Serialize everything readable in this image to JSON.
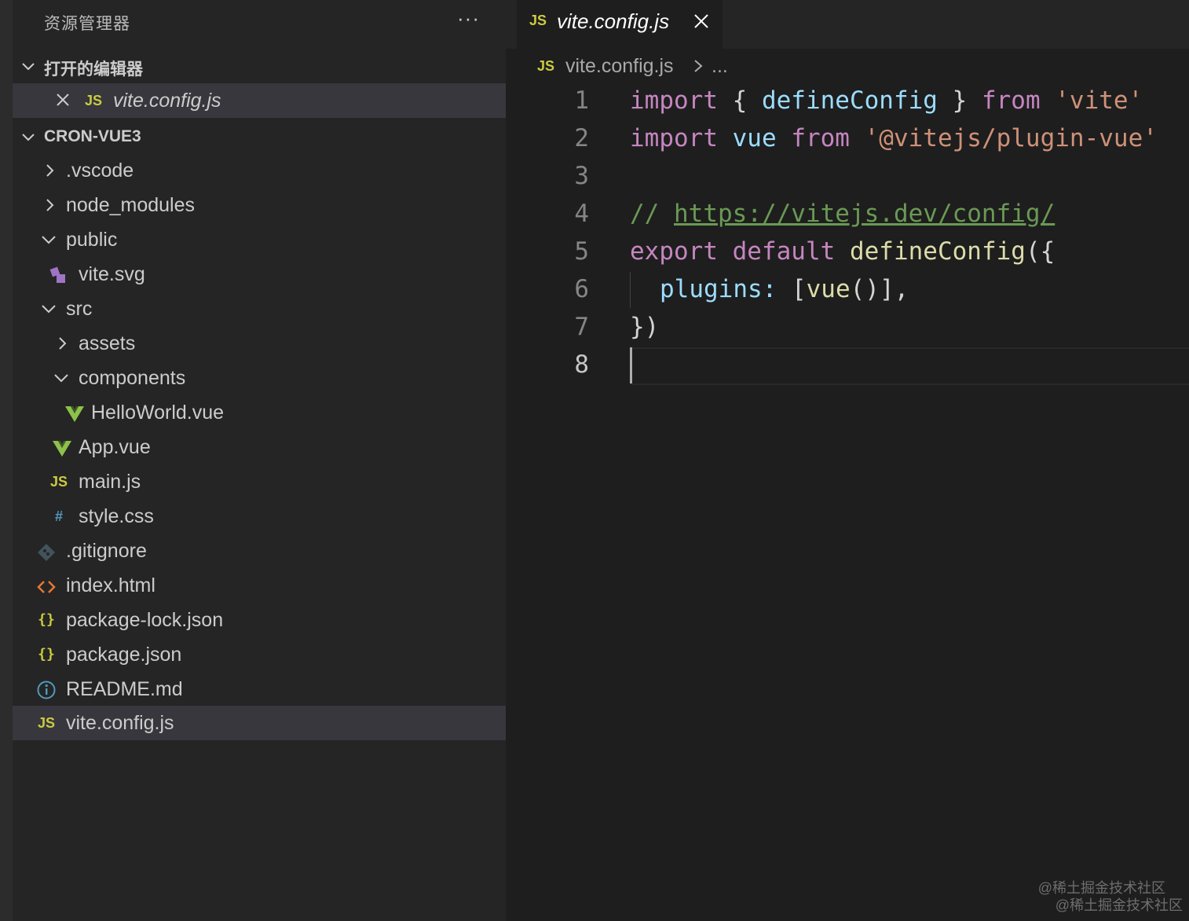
{
  "sidebar": {
    "title": "资源管理器",
    "more_label": "···",
    "open_editors_label": "打开的编辑器",
    "open_editors": [
      {
        "icon": "javascript-file-icon",
        "label": "vite.config.js"
      }
    ],
    "project_label": "CRON-VUE3",
    "tree": [
      {
        "label": ".vscode",
        "type": "folder",
        "expanded": false,
        "depth": 0
      },
      {
        "label": "node_modules",
        "type": "folder",
        "expanded": false,
        "depth": 0
      },
      {
        "label": "public",
        "type": "folder",
        "expanded": true,
        "depth": 0
      },
      {
        "label": "vite.svg",
        "type": "file",
        "icon": "svg-file-icon",
        "depth": 1
      },
      {
        "label": "src",
        "type": "folder",
        "expanded": true,
        "depth": 0
      },
      {
        "label": "assets",
        "type": "folder",
        "expanded": false,
        "depth": 1
      },
      {
        "label": "components",
        "type": "folder",
        "expanded": true,
        "depth": 1
      },
      {
        "label": "HelloWorld.vue",
        "type": "file",
        "icon": "vue-file-icon",
        "depth": 2
      },
      {
        "label": "App.vue",
        "type": "file",
        "icon": "vue-file-icon",
        "depth": 1
      },
      {
        "label": "main.js",
        "type": "file",
        "icon": "javascript-file-icon",
        "depth": 1
      },
      {
        "label": "style.css",
        "type": "file",
        "icon": "css-file-icon",
        "depth": 1
      },
      {
        "label": ".gitignore",
        "type": "file",
        "icon": "git-file-icon",
        "depth": 0
      },
      {
        "label": "index.html",
        "type": "file",
        "icon": "html-file-icon",
        "depth": 0
      },
      {
        "label": "package-lock.json",
        "type": "file",
        "icon": "json-file-icon",
        "depth": 0
      },
      {
        "label": "package.json",
        "type": "file",
        "icon": "json-file-icon",
        "depth": 0
      },
      {
        "label": "README.md",
        "type": "file",
        "icon": "info-file-icon",
        "depth": 0
      },
      {
        "label": "vite.config.js",
        "type": "file",
        "icon": "javascript-file-icon",
        "depth": 0,
        "selected": true
      }
    ]
  },
  "editor": {
    "tab_label": "vite.config.js",
    "tab_icon_text": "JS",
    "breadcrumb_file": "vite.config.js",
    "breadcrumb_ellipsis": "...",
    "line_numbers": [
      "1",
      "2",
      "3",
      "4",
      "5",
      "6",
      "7",
      "8"
    ],
    "code": {
      "l1_import": "import",
      "l1_open": " { ",
      "l1_name": "defineConfig",
      "l1_close": " } ",
      "l1_from": "from",
      "l1_str": " 'vite'",
      "l2_import": "import",
      "l2_name": " vue ",
      "l2_from": "from",
      "l2_str": " '@vitejs/plugin-vue'",
      "l4_comment": "// ",
      "l4_link": "https://vitejs.dev/config/",
      "l5_export": "export",
      "l5_default": " default ",
      "l5_fn": "defineConfig",
      "l5_punc": "({",
      "l6_key": "plugins:",
      "l6_punc1": " [",
      "l6_vue": "vue",
      "l6_punc2": "()],",
      "l7_punc": "})"
    }
  },
  "watermark": {
    "line1": "@稀土掘金技术社区",
    "line2": "@稀土掘金技术社区"
  },
  "colors": {
    "keyword": "#c586c0",
    "function": "#dcdcaa",
    "variable": "#9cdcfe",
    "string": "#ce9178",
    "comment": "#6a9955",
    "js_icon": "#cbcb41",
    "vue_icon": "#8dc149"
  }
}
